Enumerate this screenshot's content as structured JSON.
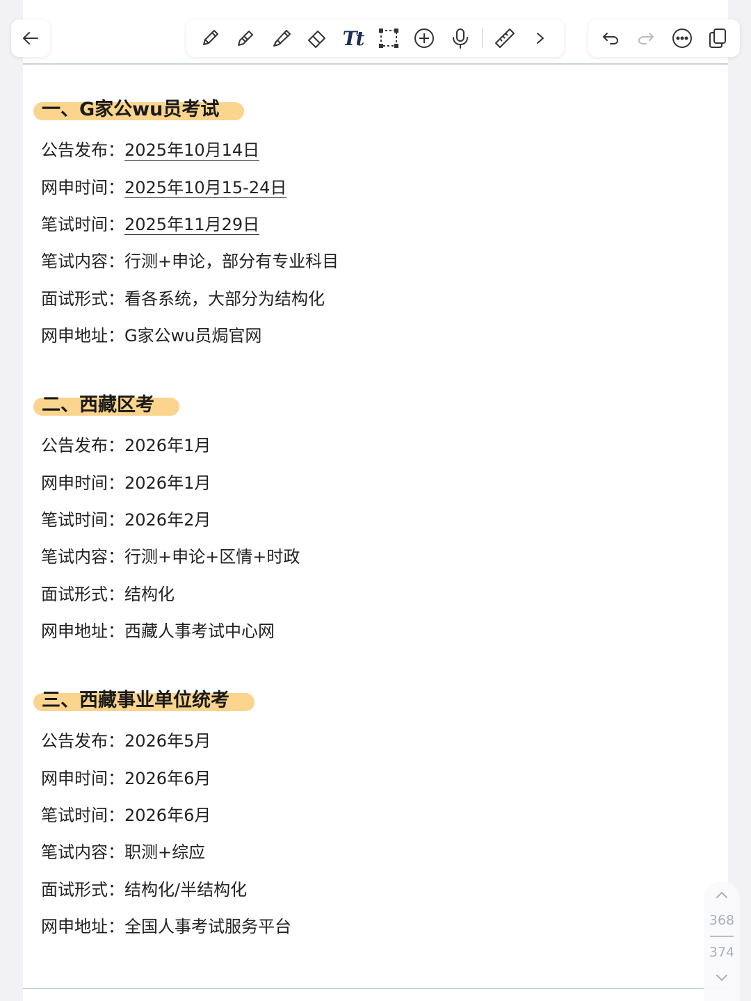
{
  "toolbar": {
    "back_icon": "arrow-left-icon",
    "tools": [
      "pen-icon",
      "pencil-icon",
      "highlighter-icon",
      "eraser-icon",
      "text-tool-icon",
      "lasso-select-icon",
      "add-icon",
      "microphone-icon",
      "ruler-icon",
      "chevron-right-icon"
    ],
    "text_tool_label": "Tt",
    "actions": [
      "undo-icon",
      "redo-icon",
      "more-icon",
      "pages-icon"
    ]
  },
  "sections": [
    {
      "title": "一、G家公wu员考试",
      "rows": [
        {
          "label": "公告发布：",
          "value": "2025年10月14日"
        },
        {
          "label": "网申时间：",
          "value": "2025年10月15-24日"
        },
        {
          "label": "笔试时间：",
          "value": "2025年11月29日"
        },
        {
          "label": "笔试内容：",
          "value": "行测+申论，部分有专业科目"
        },
        {
          "label": "面试形式：",
          "value": "看各系统，大部分为结构化"
        },
        {
          "label": "网申地址：",
          "value": "G家公wu员焗官网"
        }
      ]
    },
    {
      "title": "二、西藏区考",
      "rows": [
        {
          "label": "公告发布：",
          "value": "2026年1月"
        },
        {
          "label": "网申时间：",
          "value": "2026年1月"
        },
        {
          "label": "笔试时间：",
          "value": "2026年2月"
        },
        {
          "label": "笔试内容：",
          "value": "行测+申论+区情+时政"
        },
        {
          "label": "面试形式：",
          "value": "结构化"
        },
        {
          "label": "网申地址：",
          "value": "西藏人事考试中心网"
        }
      ]
    },
    {
      "title": "三、西藏事业单位统考",
      "rows": [
        {
          "label": "公告发布：",
          "value": "2026年5月"
        },
        {
          "label": "网申时间：",
          "value": "2026年6月"
        },
        {
          "label": "笔试时间：",
          "value": "2026年6月"
        },
        {
          "label": "笔试内容：",
          "value": "职测+综应"
        },
        {
          "label": "面试形式：",
          "value": "结构化/半结构化"
        },
        {
          "label": "网申地址：",
          "value": "全国人事考试服务平台"
        }
      ]
    }
  ],
  "pager": {
    "current_page": "368",
    "total_pages": "374"
  },
  "colors": {
    "highlight": "#fbd48d",
    "rule": "#c8d0e0",
    "pager_text": "#a9b0ba"
  }
}
